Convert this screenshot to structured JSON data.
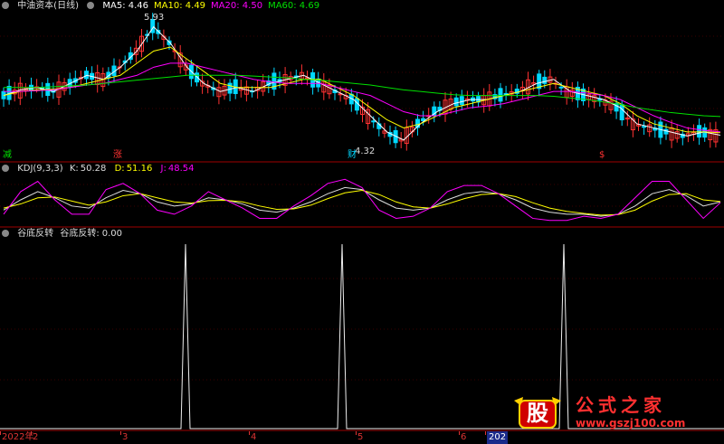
{
  "main": {
    "title": "中油资本(日线)",
    "ma": [
      {
        "label": "MA5:",
        "value": "4.46",
        "color": "#ffffff"
      },
      {
        "label": "MA10:",
        "value": "4.49",
        "color": "#ffff00"
      },
      {
        "label": "MA20:",
        "value": "4.50",
        "color": "#ff00ff"
      },
      {
        "label": "MA60:",
        "value": "4.69",
        "color": "#00e000"
      }
    ],
    "high_label": "5.93",
    "low_label": "4.32",
    "markers": {
      "left": "减",
      "mid": "涨",
      "cai": "财",
      "right": "$"
    }
  },
  "kdj": {
    "name": "KDJ(9,3,3)",
    "k_label": "K:",
    "k_value": "50.28",
    "d_label": "D:",
    "d_value": "51.16",
    "j_label": "J:",
    "j_value": "48.54"
  },
  "sub": {
    "name": "谷底反转",
    "label": "谷底反转:",
    "value": "0.00"
  },
  "axis": {
    "labels": [
      "2022年",
      "2",
      "3",
      "4",
      "5",
      "6",
      "202"
    ]
  },
  "logo": {
    "text": "公式之家",
    "url": "www.gszj100.com",
    "char": "股"
  },
  "colors": {
    "up": "#ff3232",
    "down": "#00d8ff",
    "grid": "#7a0000"
  },
  "chart_data": [
    {
      "type": "line",
      "title": "中油资本(日线)",
      "y_range": [
        4.32,
        5.93
      ],
      "series": [
        {
          "name": "MA5",
          "values": [
            4.95,
            5.02,
            5.05,
            5.0,
            5.1,
            5.2,
            5.15,
            5.3,
            5.5,
            5.8,
            5.6,
            5.3,
            5.1,
            5.0,
            5.05,
            5.0,
            5.1,
            5.15,
            5.2,
            5.1,
            5.0,
            4.9,
            4.7,
            4.5,
            4.4,
            4.6,
            4.75,
            4.85,
            4.9,
            4.9,
            4.95,
            5.0,
            5.1,
            5.15,
            5.0,
            4.95,
            4.9,
            4.8,
            4.6,
            4.55,
            4.5,
            4.45,
            4.5,
            4.46
          ]
        },
        {
          "name": "MA10",
          "values": [
            4.95,
            5.0,
            5.02,
            5.03,
            5.05,
            5.1,
            5.15,
            5.2,
            5.35,
            5.5,
            5.55,
            5.4,
            5.25,
            5.1,
            5.05,
            5.05,
            5.05,
            5.1,
            5.15,
            5.15,
            5.05,
            4.95,
            4.8,
            4.65,
            4.55,
            4.6,
            4.7,
            4.8,
            4.85,
            4.9,
            4.95,
            5.0,
            5.05,
            5.1,
            5.05,
            5.0,
            4.95,
            4.85,
            4.7,
            4.6,
            4.55,
            4.5,
            4.5,
            4.49
          ]
        },
        {
          "name": "MA20",
          "values": [
            5.0,
            5.0,
            5.01,
            5.02,
            5.05,
            5.08,
            5.1,
            5.15,
            5.2,
            5.3,
            5.35,
            5.35,
            5.3,
            5.25,
            5.2,
            5.15,
            5.12,
            5.1,
            5.1,
            5.1,
            5.05,
            5.0,
            4.95,
            4.85,
            4.75,
            4.7,
            4.7,
            4.75,
            4.8,
            4.82,
            4.85,
            4.9,
            4.95,
            5.0,
            5.0,
            4.98,
            4.95,
            4.9,
            4.8,
            4.7,
            4.62,
            4.55,
            4.52,
            4.5
          ]
        },
        {
          "name": "MA60",
          "values": [
            5.05,
            5.05,
            5.05,
            5.06,
            5.07,
            5.08,
            5.1,
            5.12,
            5.14,
            5.16,
            5.18,
            5.2,
            5.2,
            5.2,
            5.2,
            5.19,
            5.18,
            5.17,
            5.15,
            5.14,
            5.12,
            5.1,
            5.08,
            5.05,
            5.02,
            5.0,
            4.98,
            4.96,
            4.95,
            4.95,
            4.95,
            4.95,
            4.95,
            4.94,
            4.92,
            4.9,
            4.87,
            4.84,
            4.8,
            4.77,
            4.74,
            4.72,
            4.7,
            4.69
          ]
        }
      ]
    },
    {
      "type": "line",
      "title": "KDJ(9,3,3)",
      "series": [
        {
          "name": "K",
          "values": [
            30,
            55,
            75,
            60,
            40,
            35,
            60,
            78,
            70,
            50,
            40,
            45,
            60,
            55,
            45,
            30,
            25,
            35,
            50,
            70,
            85,
            80,
            55,
            35,
            30,
            35,
            55,
            70,
            75,
            70,
            55,
            35,
            25,
            20,
            20,
            15,
            20,
            40,
            70,
            80,
            65,
            40,
            50
          ]
        },
        {
          "name": "D",
          "values": [
            35,
            45,
            60,
            62,
            52,
            42,
            50,
            65,
            70,
            60,
            50,
            47,
            53,
            54,
            50,
            40,
            32,
            33,
            42,
            58,
            72,
            78,
            68,
            50,
            38,
            35,
            45,
            58,
            68,
            70,
            63,
            48,
            35,
            27,
            22,
            18,
            19,
            30,
            52,
            68,
            70,
            55,
            51
          ]
        },
        {
          "name": "J",
          "values": [
            20,
            75,
            100,
            55,
            20,
            20,
            80,
            95,
            70,
            30,
            20,
            40,
            75,
            55,
            35,
            10,
            10,
            40,
            65,
            95,
            105,
            85,
            30,
            10,
            15,
            35,
            75,
            90,
            90,
            70,
            40,
            10,
            5,
            5,
            15,
            10,
            20,
            60,
            100,
            100,
            55,
            10,
            48
          ]
        }
      ]
    },
    {
      "type": "line",
      "title": "谷底反转",
      "series": [
        {
          "name": "谷底反转",
          "values": [
            0,
            0,
            0,
            0,
            0,
            0,
            0,
            0,
            0,
            0,
            0,
            0,
            0,
            0,
            0,
            0,
            1,
            0,
            0,
            0,
            0,
            0,
            0,
            0,
            0,
            0,
            0,
            0,
            0,
            0,
            0,
            0,
            0,
            0,
            0,
            0,
            0,
            0,
            0,
            0,
            0,
            0,
            0,
            0,
            0,
            0,
            0,
            0,
            0,
            0,
            0,
            0,
            0,
            0,
            0,
            0,
            0,
            0,
            0,
            0,
            0,
            0,
            0,
            0,
            0,
            0,
            1,
            0,
            0,
            0,
            0,
            0,
            0,
            0,
            0,
            0,
            0,
            0,
            0,
            0,
            0,
            0,
            0,
            0,
            0,
            0,
            0,
            0,
            0,
            0,
            0,
            0,
            0,
            0,
            0,
            0,
            0,
            0,
            0,
            0,
            0,
            0,
            0,
            0,
            0,
            0,
            0,
            0,
            0,
            0,
            0,
            0,
            0,
            1,
            0,
            0,
            0,
            0,
            0,
            0,
            0,
            0,
            0,
            0,
            0,
            0,
            0,
            0,
            0,
            0,
            0,
            0,
            0,
            0,
            0
          ]
        }
      ]
    }
  ]
}
